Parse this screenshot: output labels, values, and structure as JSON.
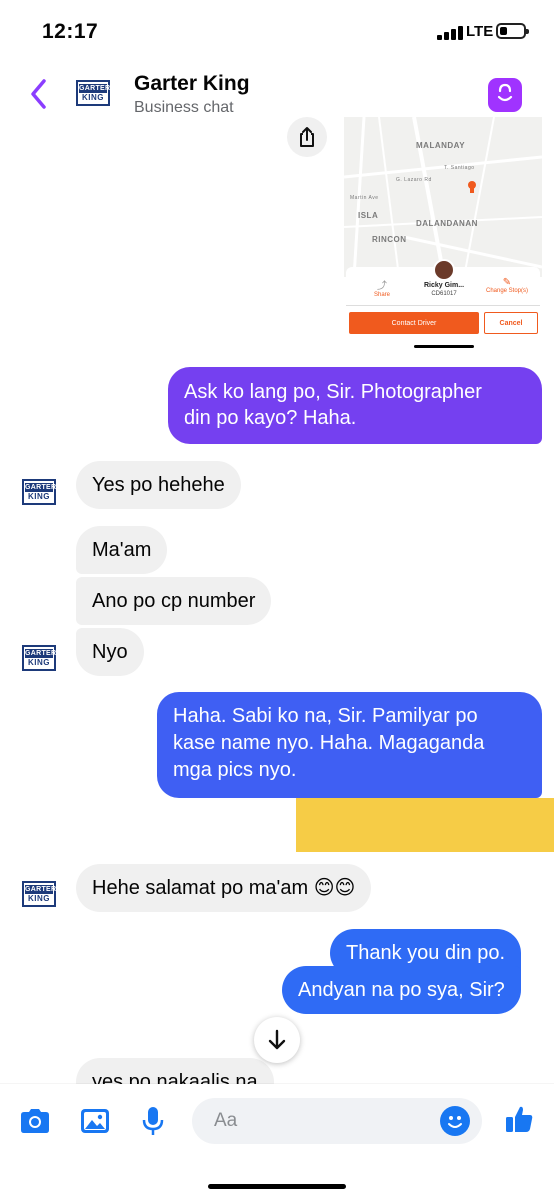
{
  "status_bar": {
    "time": "12:17",
    "network": "LTE",
    "battery_fraction": 0.3
  },
  "header": {
    "back_icon": "chevron-left-icon",
    "name": "Garter King",
    "subtitle": "Business chat",
    "logo": {
      "top": "GARTER",
      "bottom": "KING"
    },
    "shop_icon": "shopping-bag-icon"
  },
  "shared_screenshot": {
    "share_icon": "share-icon",
    "map_labels": [
      "MALANDAY",
      "ISLA",
      "DALANDANAN",
      "RINCON"
    ],
    "map_small_labels": [
      "G. Lazaro Rd",
      "T. Santiago",
      "Martin Ave"
    ],
    "driver_name": "Ricky Gim...",
    "plate": "CD61017",
    "share_label": "Share",
    "change_label": "Change Stop(s)",
    "contact_driver": "Contact Driver",
    "cancel": "Cancel"
  },
  "messages": [
    {
      "side": "out",
      "lines": [
        "Ask ko lang po, Sir. Photographer",
        "din po kayo? Haha."
      ]
    },
    {
      "side": "in",
      "lines": [
        "Yes po hehehe"
      ]
    },
    {
      "side": "in",
      "lines": [
        "Ma'am"
      ]
    },
    {
      "side": "in",
      "lines": [
        "Ano po cp number"
      ]
    },
    {
      "side": "in",
      "lines": [
        "Nyo"
      ]
    },
    {
      "side": "out",
      "lines": [
        "Haha. Sabi ko na, Sir. Pamilyar po",
        "kase name nyo. Haha. Magaganda",
        "mga pics nyo."
      ]
    },
    {
      "side": "in",
      "lines": [
        "Hehe salamat po ma'am 😊😊"
      ]
    },
    {
      "side": "out",
      "lines": [
        "Thank you din po."
      ]
    },
    {
      "side": "out",
      "lines": [
        "Andyan na po sya, Sir?"
      ]
    },
    {
      "side": "in",
      "lines": [
        "yes po nakaalis na"
      ]
    }
  ],
  "composer": {
    "placeholder": "Aa",
    "icons": [
      "camera-icon",
      "photo-icon",
      "microphone-icon",
      "emoji-icon",
      "thumbs-up-icon"
    ]
  },
  "colors": {
    "accent": "#a033ff",
    "out_bubble_top": "#7b3ff2",
    "out_bubble_bottom": "#2f6bf5",
    "in_bubble": "#f0f0f0",
    "icon_blue": "#1877f2"
  }
}
